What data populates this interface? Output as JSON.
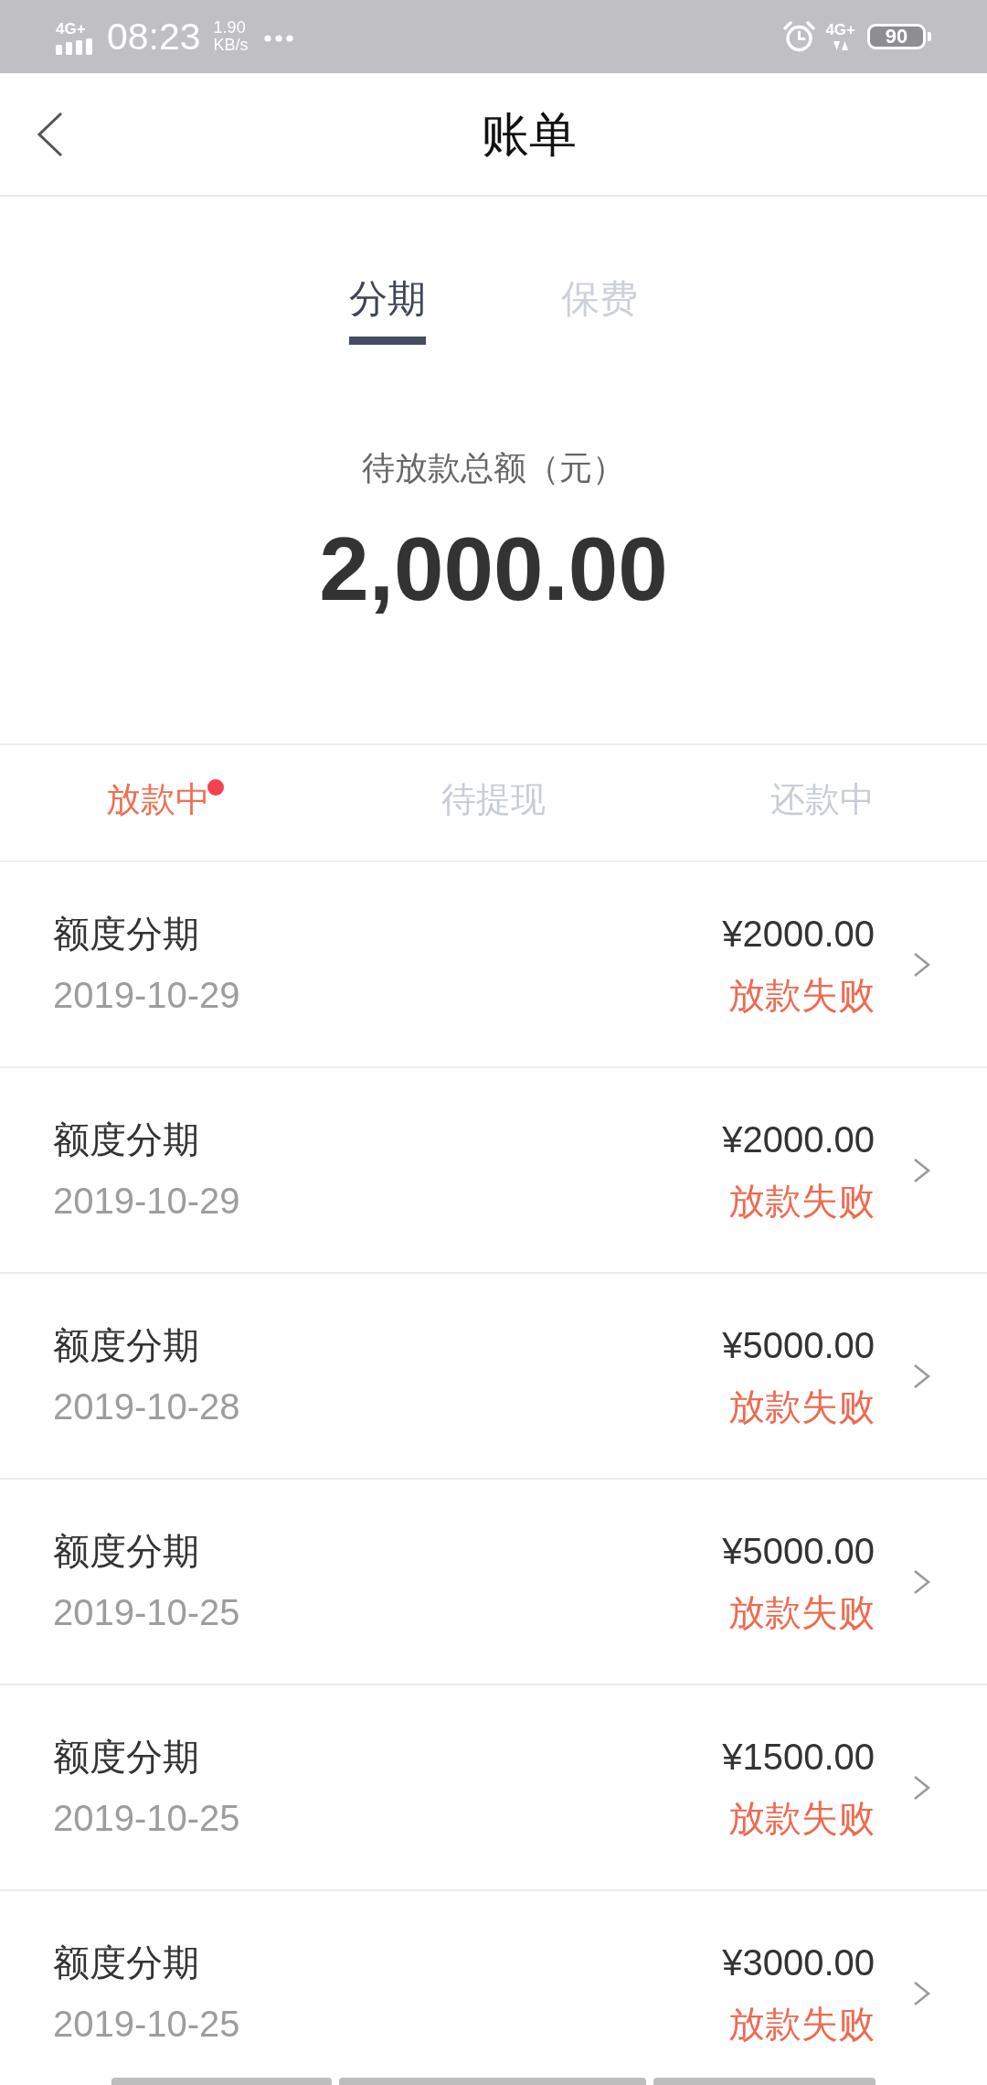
{
  "status_bar": {
    "signal_label": "4G+",
    "time": "08:23",
    "speed_value": "1.90",
    "speed_unit": "KB/s",
    "network_label": "4G+",
    "battery": "90"
  },
  "header": {
    "title": "账单"
  },
  "tabs": [
    {
      "label": "分期",
      "selected": true
    },
    {
      "label": "保费",
      "selected": false
    }
  ],
  "summary": {
    "label": "待放款总额（元）",
    "amount": "2,000.00"
  },
  "filter_tabs": [
    {
      "label": "放款中",
      "selected": true,
      "badge": true
    },
    {
      "label": "待提现",
      "selected": false,
      "badge": false
    },
    {
      "label": "还款中",
      "selected": false,
      "badge": false
    }
  ],
  "bills": [
    {
      "title": "额度分期",
      "date": "2019-10-29",
      "amount": "¥2000.00",
      "status": "放款失败"
    },
    {
      "title": "额度分期",
      "date": "2019-10-29",
      "amount": "¥2000.00",
      "status": "放款失败"
    },
    {
      "title": "额度分期",
      "date": "2019-10-28",
      "amount": "¥5000.00",
      "status": "放款失败"
    },
    {
      "title": "额度分期",
      "date": "2019-10-25",
      "amount": "¥5000.00",
      "status": "放款失败"
    },
    {
      "title": "额度分期",
      "date": "2019-10-25",
      "amount": "¥1500.00",
      "status": "放款失败"
    },
    {
      "title": "额度分期",
      "date": "2019-10-25",
      "amount": "¥3000.00",
      "status": "放款失败"
    }
  ]
}
